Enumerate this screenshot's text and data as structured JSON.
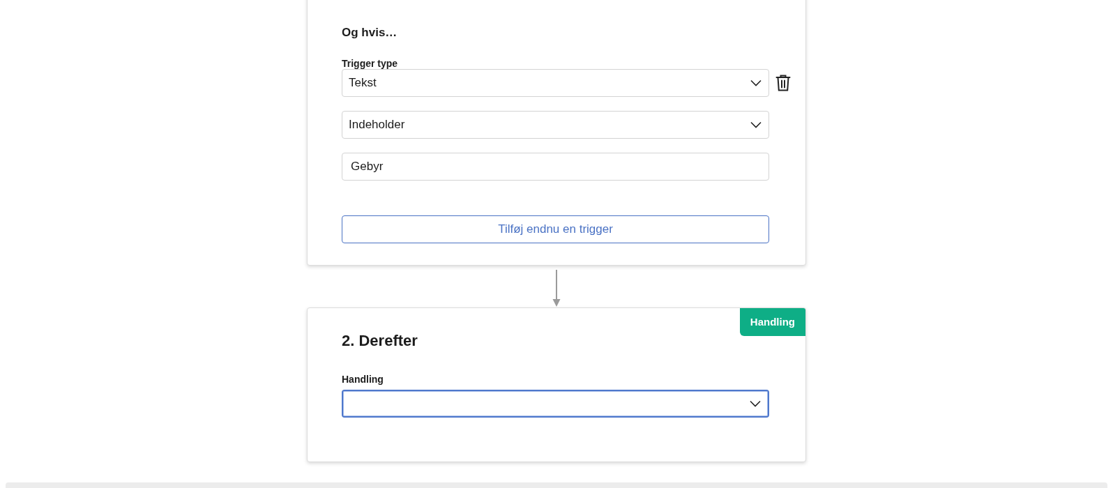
{
  "trigger_card": {
    "heading": "Og hvis…",
    "field_label": "Trigger type",
    "selects": [
      {
        "value": "Tekst",
        "deletable": true
      },
      {
        "value": "Indeholder",
        "deletable": false
      }
    ],
    "text_input": {
      "value": "Gebyr"
    },
    "add_button": "Tilføj endnu en trigger"
  },
  "action_card": {
    "badge": "Handling",
    "heading": "2. Derefter",
    "field_label": "Handling",
    "select": {
      "focused": true
    }
  }
}
